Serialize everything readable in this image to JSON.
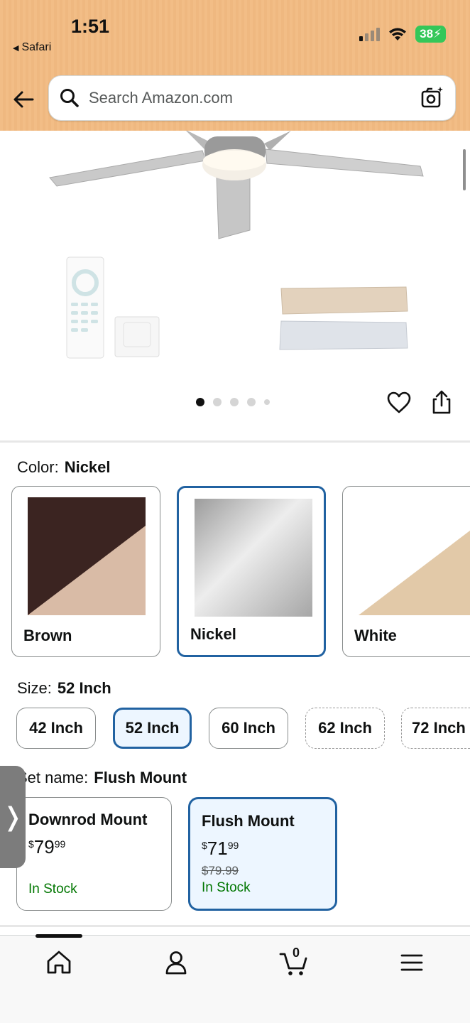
{
  "status_bar": {
    "time": "1:51",
    "back_app": "Safari",
    "battery": "38"
  },
  "search": {
    "placeholder": "Search Amazon.com"
  },
  "gallery": {
    "dot_count": 5,
    "active_dot": 0
  },
  "color": {
    "label": "Color:",
    "selected": "Nickel",
    "options": [
      {
        "name": "Brown"
      },
      {
        "name": "Nickel"
      },
      {
        "name": "White"
      }
    ]
  },
  "size": {
    "label": "Size:",
    "selected": "52 Inch",
    "options": [
      "42 Inch",
      "52 Inch",
      "60 Inch",
      "62 Inch",
      "72 Inch"
    ]
  },
  "set_name": {
    "label": "Set name:",
    "selected": "Flush Mount",
    "options": [
      {
        "name": "Downrod Mount",
        "price_whole": "79",
        "price_fraction": "99",
        "currency": "$",
        "list_price": "",
        "stock": "In Stock"
      },
      {
        "name": "Flush Mount",
        "price_whole": "71",
        "price_fraction": "99",
        "currency": "$",
        "list_price": "$79.99",
        "stock": "In Stock"
      }
    ]
  },
  "bottom_nav": {
    "cart_count": "0"
  },
  "colors": {
    "accent": "#2162a1",
    "in_stock": "#007600",
    "header_bg": "#f2bd86"
  }
}
